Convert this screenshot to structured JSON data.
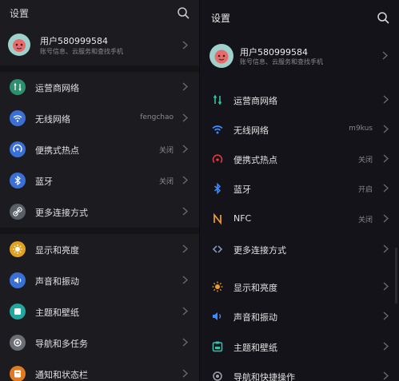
{
  "left": {
    "title": "设置",
    "profile": {
      "name": "用户580999584",
      "subtitle": "账号信息、云服务和查找手机"
    },
    "items": [
      {
        "label": "运营商网络",
        "value": "",
        "icon": "cellular-icon",
        "color": "#2e8f6e"
      },
      {
        "label": "无线网络",
        "value": "fengchao",
        "icon": "wifi-icon",
        "color": "#3a6fd6"
      },
      {
        "label": "便携式热点",
        "value": "关闭",
        "icon": "hotspot-icon",
        "color": "#3a6fd6"
      },
      {
        "label": "蓝牙",
        "value": "关闭",
        "icon": "bluetooth-icon",
        "color": "#3a6fd6"
      },
      {
        "label": "更多连接方式",
        "value": "",
        "icon": "link-icon",
        "color": "#5a5f66"
      },
      {
        "label": "显示和亮度",
        "value": "",
        "icon": "brightness-icon",
        "color": "#e0a020"
      },
      {
        "label": "声音和振动",
        "value": "",
        "icon": "sound-icon",
        "color": "#3a6fd6"
      },
      {
        "label": "主题和壁纸",
        "value": "",
        "icon": "theme-icon",
        "color": "#23a6a0"
      },
      {
        "label": "导航和多任务",
        "value": "",
        "icon": "navigation-icon",
        "color": "#6b6f75"
      },
      {
        "label": "通知和状态栏",
        "value": "",
        "icon": "notification-icon",
        "color": "#e07a20"
      }
    ]
  },
  "right": {
    "title": "设置",
    "profile": {
      "name": "用户580999584",
      "subtitle": "账号信息、云服务和查找手机"
    },
    "items": [
      {
        "label": "运营商网络",
        "value": "",
        "icon": "cellular-icon",
        "color": "#2ec49a"
      },
      {
        "label": "无线网络",
        "value": "m9kus",
        "icon": "wifi-icon",
        "color": "#3d8bff"
      },
      {
        "label": "便携式热点",
        "value": "关闭",
        "icon": "hotspot-icon",
        "color": "#e03a3a"
      },
      {
        "label": "蓝牙",
        "value": "开启",
        "icon": "bluetooth-icon",
        "color": "#3d8bff"
      },
      {
        "label": "NFC",
        "value": "关闭",
        "icon": "nfc-icon",
        "color": "#f0a020"
      },
      {
        "label": "更多连接方式",
        "value": "",
        "icon": "link-icon",
        "color": "#8fa0c0"
      },
      {
        "label": "显示和亮度",
        "value": "",
        "icon": "brightness-icon",
        "color": "#f0a020"
      },
      {
        "label": "声音和振动",
        "value": "",
        "icon": "sound-icon",
        "color": "#3d8bff"
      },
      {
        "label": "主题和壁纸",
        "value": "",
        "icon": "theme-icon",
        "color": "#2ec4b0"
      },
      {
        "label": "导航和快捷操作",
        "value": "",
        "icon": "navigation-icon",
        "color": "#a0a4aa"
      }
    ]
  }
}
